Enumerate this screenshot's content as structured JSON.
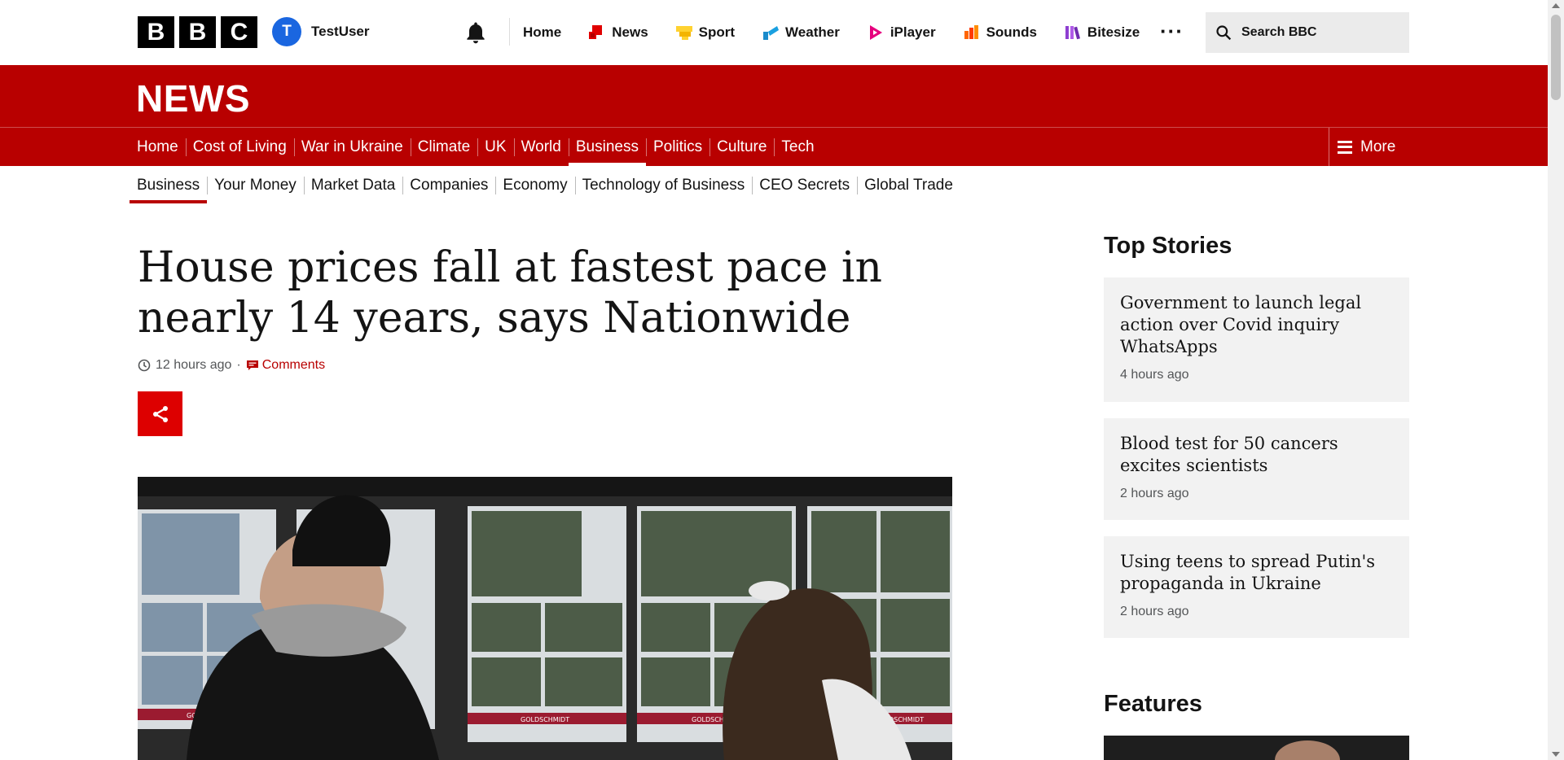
{
  "masthead": {
    "logo_letters": [
      "B",
      "B",
      "C"
    ],
    "account": {
      "initial": "T",
      "name": "TestUser"
    },
    "nav": [
      {
        "label": "Home",
        "icon": "none"
      },
      {
        "label": "News",
        "icon": "news-icon",
        "color": "#e00000"
      },
      {
        "label": "Sport",
        "icon": "sport-icon",
        "color": "#ffd230"
      },
      {
        "label": "Weather",
        "icon": "weather-icon",
        "color": "#1a8bcb"
      },
      {
        "label": "iPlayer",
        "icon": "iplayer-icon",
        "color": "#e6007e"
      },
      {
        "label": "Sounds",
        "icon": "sounds-icon",
        "color": "#ff6600"
      },
      {
        "label": "Bitesize",
        "icon": "bitesize-icon",
        "color": "#8e3fd1"
      }
    ],
    "more_label": "···",
    "search_placeholder": "Search BBC"
  },
  "banner": {
    "title": "NEWS"
  },
  "section_nav": {
    "items": [
      "Home",
      "Cost of Living",
      "War in Ukraine",
      "Climate",
      "UK",
      "World",
      "Business",
      "Politics",
      "Culture",
      "Tech"
    ],
    "active": "Business",
    "more_label": "More"
  },
  "sub_nav": {
    "items": [
      "Business",
      "Your Money",
      "Market Data",
      "Companies",
      "Economy",
      "Technology of Business",
      "CEO Secrets",
      "Global Trade"
    ],
    "active": "Business"
  },
  "article": {
    "headline": "House prices fall at fastest pace in nearly 14 years, says Nationwide",
    "timestamp": "12 hours ago",
    "separator": "·",
    "comments_label": "Comments",
    "hero_sign_text": "GOLDSCHMIDT"
  },
  "sidebar": {
    "top_stories_heading": "Top Stories",
    "stories": [
      {
        "title": "Government to launch legal action over Covid inquiry WhatsApps",
        "time": "4 hours ago"
      },
      {
        "title": "Blood test for 50 cancers excites scientists",
        "time": "2 hours ago"
      },
      {
        "title": "Using teens to spread Putin's propaganda in Ukraine",
        "time": "2 hours ago"
      }
    ],
    "features_heading": "Features"
  },
  "colors": {
    "bbc_red": "#b80000",
    "share_red": "#dd0000",
    "card_bg": "#f2f2f2",
    "avatar_blue": "#1a66e0"
  }
}
